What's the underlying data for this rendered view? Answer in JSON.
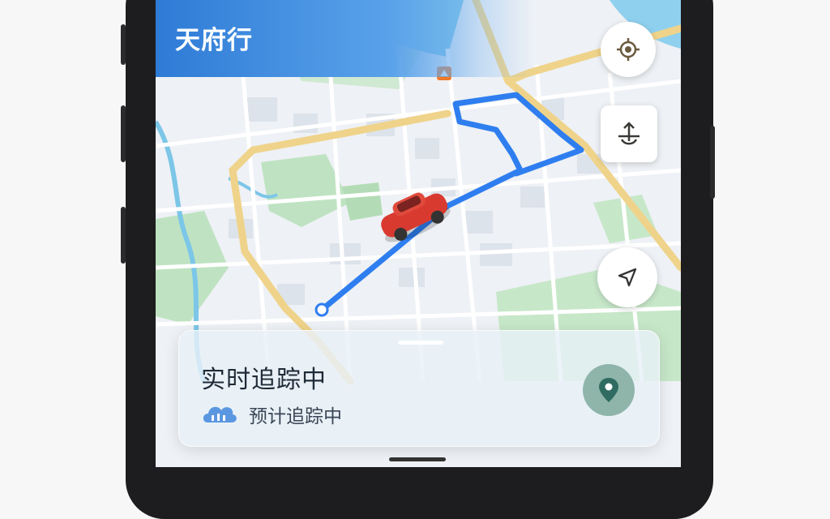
{
  "app": {
    "title": "天府行"
  },
  "map": {
    "controls": {
      "locate_icon": "crosshair-icon",
      "layers_icon": "layers-icon",
      "navigate_icon": "navigation-arrow-icon"
    },
    "route_color": "#2f7ef0",
    "vehicle": "red-car-icon",
    "poi_icon": "shop-marker-icon"
  },
  "tracking_panel": {
    "title": "实时追踪中",
    "subtitle": "预计追踪中",
    "subtitle_icon": "cloud-icon",
    "action_icon": "location-pin-icon"
  },
  "colors": {
    "header_blue": "#2e7bd6",
    "road_major": "#efd38a",
    "park_green": "#bfe3c2",
    "water": "#7cc6e8"
  }
}
